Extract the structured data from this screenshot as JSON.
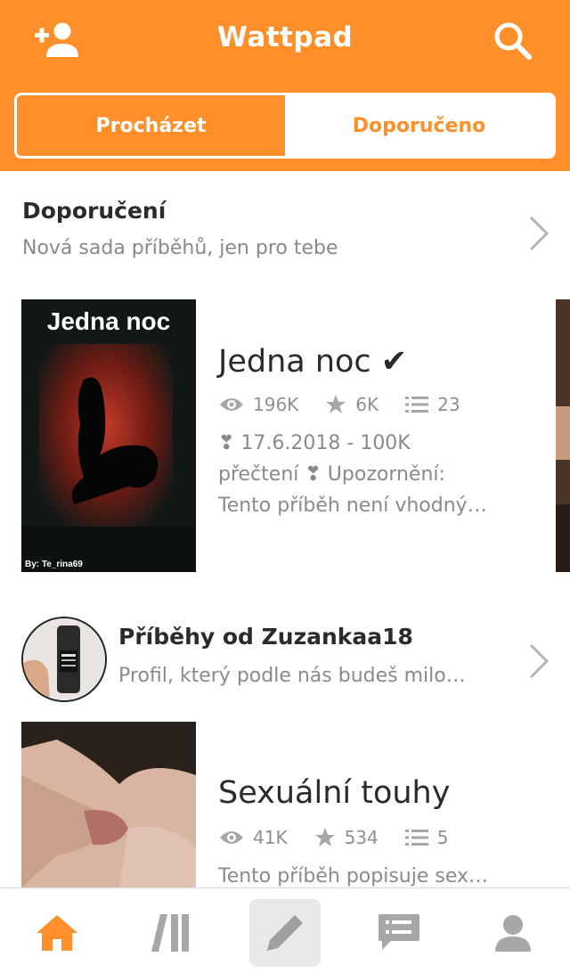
{
  "header": {
    "title": "Wattpad",
    "icons": {
      "left": "add-user-icon",
      "right": "search-icon"
    },
    "tabs": [
      {
        "label": "Procházet",
        "active": true
      },
      {
        "label": "Doporučeno",
        "active": false
      }
    ],
    "accent_color": "#ff8f2a"
  },
  "recommendations": {
    "title": "Doporučení",
    "subtitle": "Nová sada příběhů, jen pro tebe",
    "story": {
      "cover_text": "Jedna noc",
      "cover_credit": "By: Te_rina69",
      "title": "Jedna noc ✔",
      "reads": "196K",
      "votes": "6K",
      "parts": "23",
      "description_lines": [
        "❣ 17.6.2018 - 100K",
        "přečtení ❣ Upozornění:",
        "Tento příběh není vhodný…"
      ]
    }
  },
  "profile_section": {
    "title": "Příběhy od Zuzankaa18",
    "subtitle": "Profil, který podle nás budeš milo…",
    "story": {
      "title": "Sexuální touhy",
      "reads": "41K",
      "votes": "534",
      "parts": "5",
      "description": "Tento příběh popisuje sex…"
    }
  },
  "bottom_nav": {
    "items": [
      "home-icon",
      "library-icon",
      "write-icon",
      "messages-icon",
      "profile-icon"
    ],
    "active": "home-icon"
  }
}
